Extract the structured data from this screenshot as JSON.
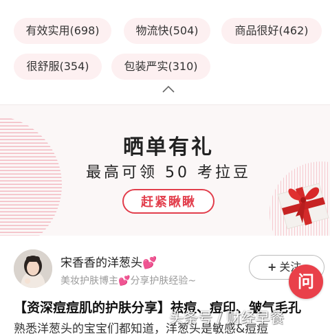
{
  "tags": [
    {
      "label": "有效实用(698)"
    },
    {
      "label": "物流快(504)"
    },
    {
      "label": "商品很好(462)"
    },
    {
      "label": "很舒服(354)"
    },
    {
      "label": "包装严实(310)"
    }
  ],
  "collapse_icon": "chevron-up-icon",
  "banner": {
    "title": "晒单有礼",
    "subtitle": "最高可领 50 考拉豆",
    "button": "赶紧瞅瞅",
    "gift_icon": "gift-box-icon",
    "accent_color": "#e23d4b"
  },
  "post": {
    "author_name": "宋香香的洋葱头",
    "author_desc": "美妆护肤博主",
    "author_desc2": "分享护肤经验~",
    "follow_label": "关注",
    "ask_label": "问",
    "title": "【资深痘痘肌的护肤分享】祛痘、痘印、皱气毛孔",
    "body": "熟悉洋葱头的宝宝们都知道，洋葱头是敏感&痘痘",
    "watermark": "头条号 / 财经早餐"
  }
}
